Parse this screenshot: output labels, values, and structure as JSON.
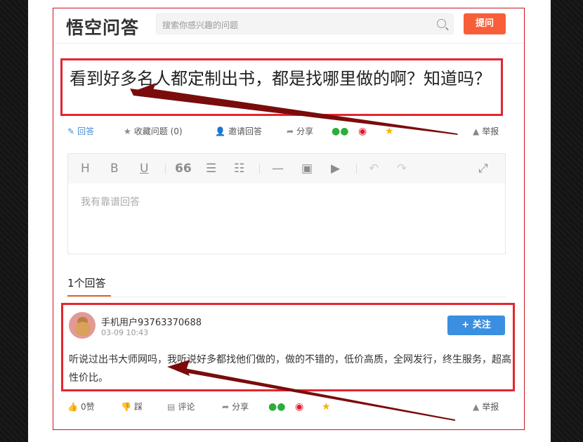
{
  "header": {
    "logo": "悟空问答",
    "search_placeholder": "搜索你感兴趣的问题",
    "ask_label": "提问"
  },
  "question": {
    "title": "看到好多名人都定制出书，都是找哪里做的啊？知道吗？"
  },
  "question_actions": {
    "answer": "回答",
    "favorite": "收藏问题 (0)",
    "invite": "邀请回答",
    "share": "分享",
    "report": "举报"
  },
  "editor": {
    "placeholder": "我有靠谱回答",
    "toolbar": [
      "H",
      "B",
      "U",
      "66"
    ]
  },
  "answers": {
    "count_label": "1个回答",
    "items": [
      {
        "user": "手机用户93763370688",
        "time": "03-09 10:43",
        "follow_label": "+ 关注",
        "text": "听说过出书大师网吗，我听说好多都找他们做的，做的不错的，低价高质，全网发行，终生服务，超高性价比。",
        "likes": "0赞",
        "dislike": "踩",
        "comment": "评论",
        "share": "分享",
        "report": "举报"
      }
    ]
  },
  "colors": {
    "accent_orange": "#f85e3a",
    "follow_blue": "#3b8fe0",
    "highlight_red": "#e3262f",
    "arrow_dark_red": "#7a0c0c"
  }
}
